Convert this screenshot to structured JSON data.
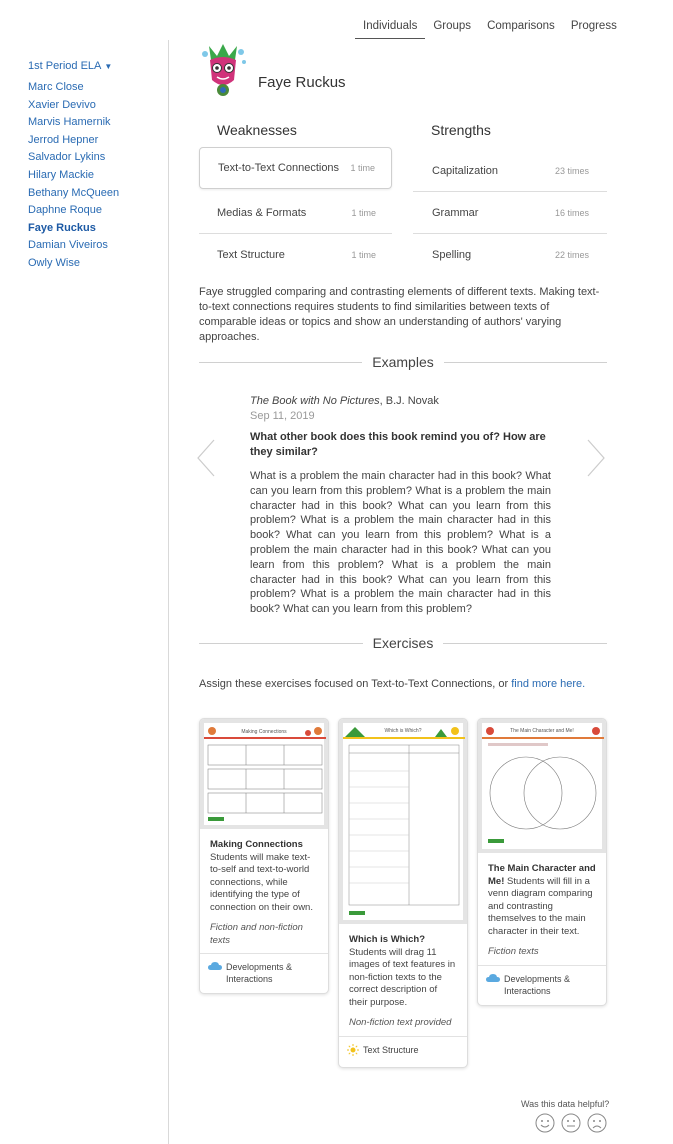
{
  "nav": {
    "tabs": [
      {
        "label": "Individuals",
        "active": true
      },
      {
        "label": "Groups",
        "active": false
      },
      {
        "label": "Comparisons",
        "active": false
      },
      {
        "label": "Progress",
        "active": false
      }
    ]
  },
  "sidebar": {
    "class_select": "1st Period ELA",
    "students": [
      {
        "name": "Marc Close",
        "active": false
      },
      {
        "name": "Xavier Devivo",
        "active": false
      },
      {
        "name": "Marvis Hamernik",
        "active": false
      },
      {
        "name": "Jerrod Hepner",
        "active": false
      },
      {
        "name": "Salvador Lykins",
        "active": false
      },
      {
        "name": "Hilary Mackie",
        "active": false
      },
      {
        "name": "Bethany McQueen",
        "active": false
      },
      {
        "name": "Daphne Roque",
        "active": false
      },
      {
        "name": "Faye Ruckus",
        "active": true
      },
      {
        "name": "Damian Viveiros",
        "active": false
      },
      {
        "name": "Owly Wise",
        "active": false
      }
    ]
  },
  "student": {
    "name": "Faye Ruckus",
    "avatar_icon": "monster-avatar-icon"
  },
  "weaknesses": {
    "title": "Weaknesses",
    "items": [
      {
        "label": "Text-to-Text Connections",
        "count": "1 time",
        "selected": true
      },
      {
        "label": "Medias & Formats",
        "count": "1 time",
        "selected": false
      },
      {
        "label": "Text Structure",
        "count": "1 time",
        "selected": false
      }
    ]
  },
  "strengths": {
    "title": "Strengths",
    "items": [
      {
        "label": "Capitalization",
        "count": "23 times"
      },
      {
        "label": "Grammar",
        "count": "16 times"
      },
      {
        "label": "Spelling",
        "count": "22 times"
      }
    ]
  },
  "description": "Faye struggled comparing and contrasting elements of different texts. Making text-to-text connections requires students to find similarities between texts of comparable ideas or topics and show an understanding of authors' varying approaches.",
  "examples": {
    "title": "Examples",
    "book_title": "The Book with No Pictures",
    "book_author": ", B.J. Novak",
    "date": "Sep 11, 2019",
    "question": "What other book does this book remind you of? How are they similar?",
    "answer": "What is a problem the main character had in this book? What can you learn from this problem? What is a problem the main character had in this book? What can you learn from this problem? What is a problem the main character had in this book? What can you learn from this problem? What is a problem the main character had in this book? What can you learn from this problem? What is a problem the main character had in this book? What can you learn from this problem? What is a problem the main character had in this book? What can you learn from this problem?"
  },
  "exercises": {
    "title": "Exercises",
    "assign_text": "Assign these exercises focused on Text-to-Text Connections, or ",
    "assign_link": "find more here.",
    "cards": [
      {
        "thumb_title": "Making Connections",
        "title": "Making Connections",
        "description": " Students will make text-to-self and text-to-world connections, while identifying the type of connection on their own.",
        "genre": "Fiction and non-fiction texts",
        "tag": "Developments & Interactions",
        "tag_icon": "cloud-icon"
      },
      {
        "thumb_title": "Which is Which?",
        "title": "Which is Which?",
        "description": " Students will drag 11 images of text features in non-fiction texts to the correct description of their purpose.",
        "genre": "Non-fiction text provided",
        "tag": "Text Structure",
        "tag_icon": "sun-icon"
      },
      {
        "thumb_title": "The Main Character and Me!",
        "title": "The Main Character and Me!",
        "description": " Students will fill in a venn diagram comparing and contrasting themselves to the main character in their text.",
        "genre": "Fiction texts",
        "tag": "Developments & Interactions",
        "tag_icon": "cloud-icon"
      }
    ]
  },
  "feedback": {
    "question": "Was this data helpful?"
  },
  "colors": {
    "link": "#2a6bb3",
    "accent_green": "#3a9a3a",
    "cloud_blue": "#5aa9e0",
    "sun_yellow": "#f2c21b"
  }
}
